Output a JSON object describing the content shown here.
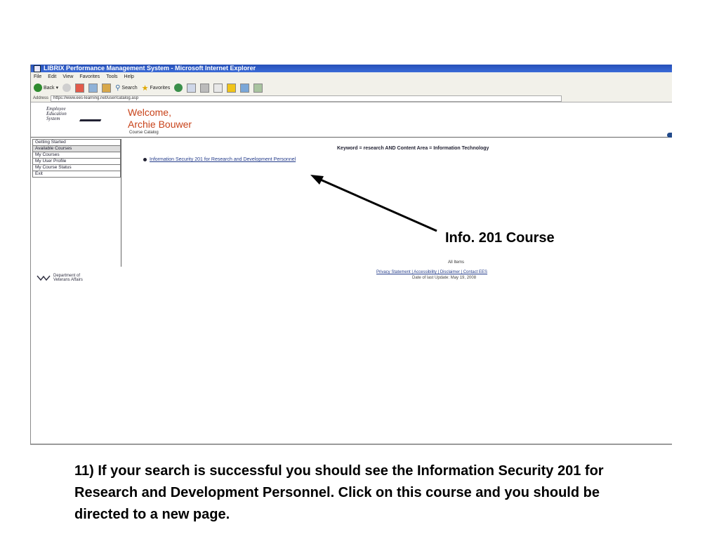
{
  "window": {
    "title": "LIBRIX Performance Management System - Microsoft Internet Explorer"
  },
  "menu": [
    "File",
    "Edit",
    "View",
    "Favorites",
    "Tools",
    "Help"
  ],
  "toolbar": {
    "back_label": "Back",
    "search_label": "Search",
    "favorites_label": "Favorites"
  },
  "address": {
    "label": "Address",
    "url": "https://www.ees-learning.net/user/catalog.asp"
  },
  "header": {
    "logo_line1": "Employee",
    "logo_line2": "Education",
    "logo_line3": "System",
    "welcome": "Welcome,",
    "user_name": "Archie Bouwer",
    "breadcrumb": "Course Catalog"
  },
  "sidebar": {
    "items": [
      {
        "label": "Getting Started",
        "active": false
      },
      {
        "label": "Available Courses",
        "active": true
      },
      {
        "label": "My Courses",
        "active": false
      },
      {
        "label": "My User Profile",
        "active": false
      },
      {
        "label": "My Course Status",
        "active": false
      },
      {
        "label": "Exit",
        "active": false
      }
    ]
  },
  "main": {
    "keyword_line": "Keyword = research AND Content Area = Information Technology",
    "course_link": "Information Security 201 for Research and Development Personnel"
  },
  "footer": {
    "all_items": "All Items",
    "links": "Privacy Statement | Accessibility | Disclaimer | Contact EES",
    "last_update": "Date of last Update: May 19, 2008",
    "va_line1": "Department of",
    "va_line2": "Veterans Affairs"
  },
  "annotation": {
    "callout": "Info. 201 Course",
    "caption": "11) If your search is successful you should see the Information Security 201 for Research and Development Personnel. Click on this course and you should be directed to a new page."
  },
  "colors": {
    "welcome": "#c8431a",
    "link": "#233b8a",
    "titlebar": "#2650b8"
  },
  "icons": [
    "back-icon",
    "forward-icon",
    "stop-icon",
    "refresh-icon",
    "home-icon",
    "search-icon",
    "favorites-star-icon",
    "history-icon",
    "mail-icon",
    "print-icon",
    "edit-icon",
    "folder-icon",
    "messenger-icon",
    "page-icon",
    "bullet-icon",
    "va-logo-icon"
  ]
}
